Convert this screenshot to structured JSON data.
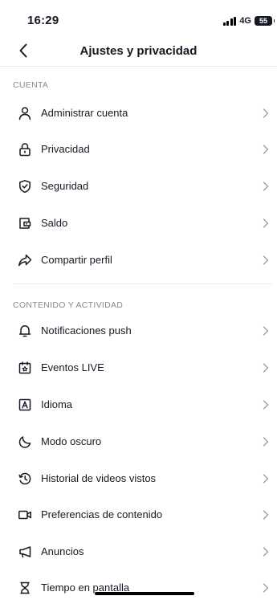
{
  "status": {
    "time": "16:29",
    "network": "4G",
    "battery": "55"
  },
  "header": {
    "title": "Ajustes y privacidad"
  },
  "sections": [
    {
      "title": "CUENTA",
      "items": [
        {
          "label": "Administrar cuenta",
          "icon": "person-icon"
        },
        {
          "label": "Privacidad",
          "icon": "lock-icon"
        },
        {
          "label": "Seguridad",
          "icon": "shield-icon"
        },
        {
          "label": "Saldo",
          "icon": "wallet-icon"
        },
        {
          "label": "Compartir perfil",
          "icon": "share-icon"
        }
      ]
    },
    {
      "title": "CONTENIDO Y ACTIVIDAD",
      "items": [
        {
          "label": "Notificaciones push",
          "icon": "bell-icon"
        },
        {
          "label": "Eventos LIVE",
          "icon": "calendar-icon"
        },
        {
          "label": "Idioma",
          "icon": "language-icon"
        },
        {
          "label": "Modo oscuro",
          "icon": "moon-icon"
        },
        {
          "label": "Historial de videos vistos",
          "icon": "history-icon"
        },
        {
          "label": "Preferencias de contenido",
          "icon": "video-camera-icon"
        },
        {
          "label": "Anuncios",
          "icon": "megaphone-icon"
        },
        {
          "label": "Tiempo en pantalla",
          "icon": "hourglass-icon"
        }
      ]
    }
  ],
  "colors": {
    "text": "#161823",
    "secondary": "#8a8b91",
    "divider": "#ebebeb",
    "chevron": "#9b9ca3"
  }
}
